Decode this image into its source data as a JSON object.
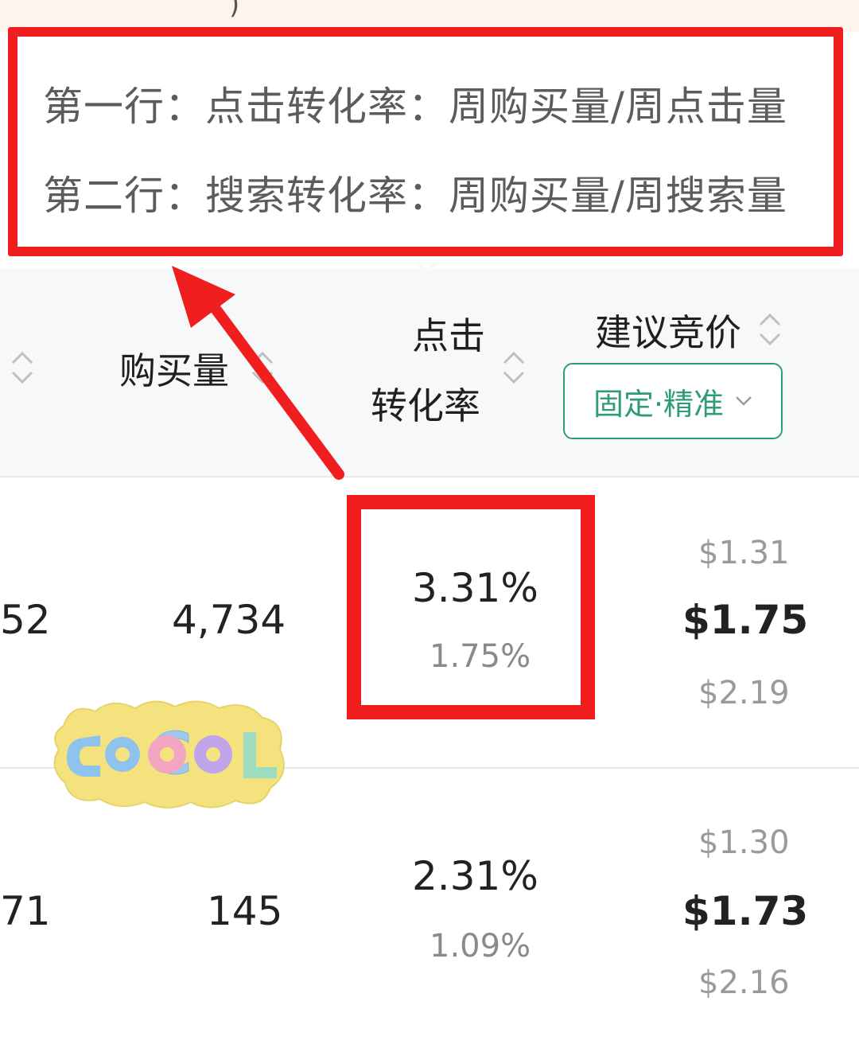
{
  "tooltip": {
    "line1": "第一行：点击转化率：周购买量/周点击量",
    "line2": "第二行：搜索转化率：周购买量/周搜索量"
  },
  "table": {
    "headers": {
      "purchase": "购买量",
      "ctr_line1": "点击",
      "ctr_line2": "转化率",
      "bid": "建议竞价"
    },
    "bid_filter": {
      "selected": "固定·精准"
    },
    "rows": [
      {
        "prev_col_partial": "52",
        "purchase": "4,734",
        "click_conv": "3.31%",
        "search_conv": "1.75%",
        "bid_low": "$1.31",
        "bid_mid": "$1.75",
        "bid_high": "$2.19"
      },
      {
        "prev_col_partial": "71",
        "purchase": "145",
        "click_conv": "2.31%",
        "search_conv": "1.09%",
        "bid_low": "$1.30",
        "bid_mid": "$1.73",
        "bid_high": "$2.16"
      }
    ]
  },
  "sticker": {
    "text": "COOL"
  },
  "colors": {
    "highlight_red": "#f01e1e",
    "accent_green": "#2e9c74"
  }
}
